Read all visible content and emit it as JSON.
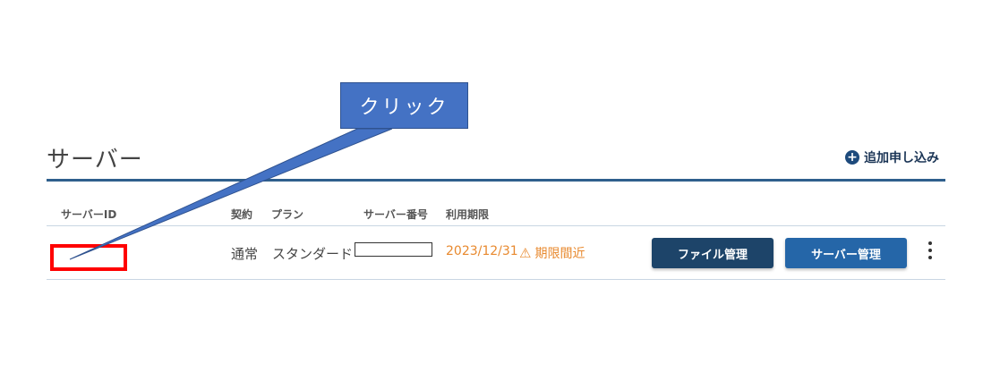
{
  "section": {
    "title": "サーバー",
    "add_label": "追加申し込み",
    "add_icon": "plus-circle-icon"
  },
  "table": {
    "headers": {
      "server_id": "サーバーID",
      "contract": "契約",
      "plan": "プラン",
      "server_number": "サーバー番号",
      "expiry": "利用期限"
    },
    "row": {
      "contract": "通常",
      "plan": "スタンダード",
      "expiry_date": "2023/12/31",
      "expiry_warning": "期限間近",
      "warning_icon": "warning-triangle-icon",
      "file_button": "ファイル管理",
      "server_button": "サーバー管理",
      "more_icon": "kebab-menu-icon"
    }
  },
  "annotation": {
    "callout_label": "クリック",
    "highlight_color": "#ff0000",
    "callout_color": "#4472c4"
  },
  "colors": {
    "accent": "#2f5f8d",
    "warning": "#e8892e",
    "file_button": "#1d4469",
    "server_button": "#2566a8"
  }
}
